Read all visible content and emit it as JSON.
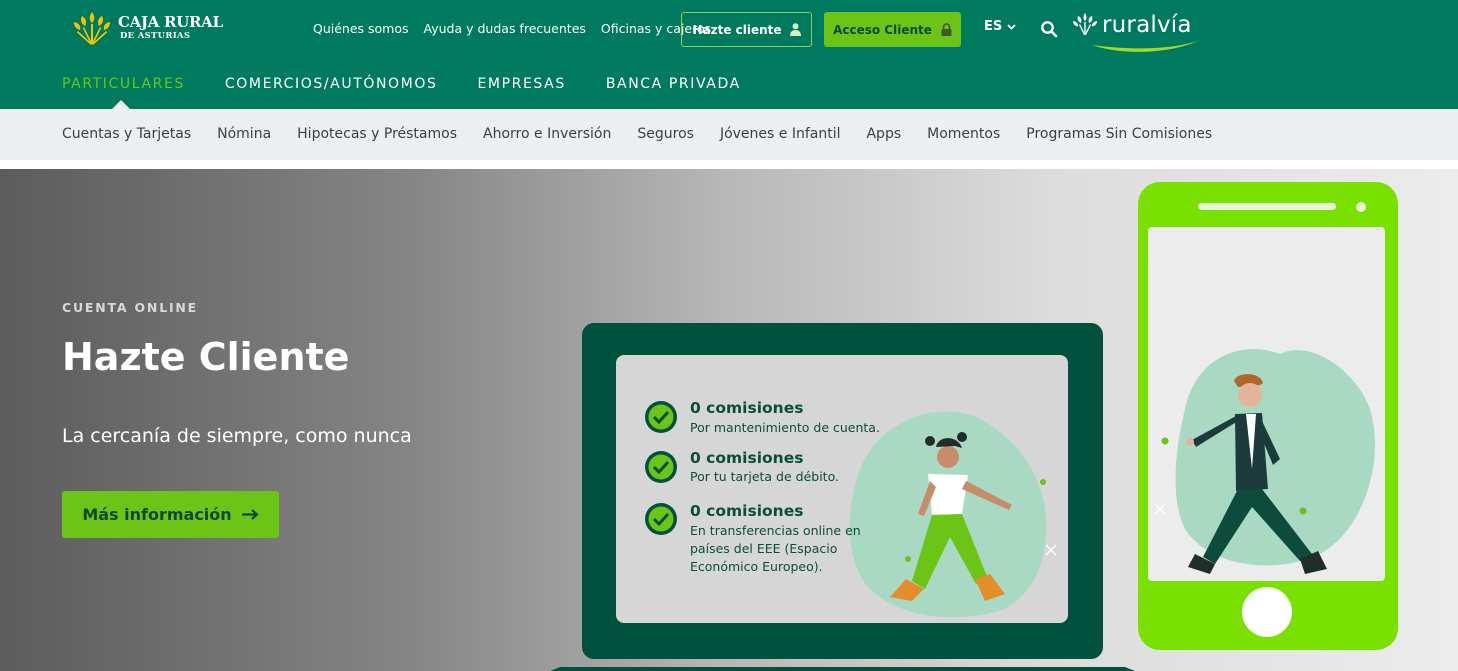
{
  "header": {
    "logo_line1": "CAJA RURAL",
    "logo_line2": "DE ASTURIAS",
    "links": [
      "Quiénes somos",
      "Ayuda y dudas frecuentes",
      "Oficinas y cajeros"
    ],
    "hazte_cliente": "Hazte cliente",
    "acceso_cliente": "Acceso Cliente",
    "language": "ES",
    "ruralvia": "ruralvía",
    "brand_color": "#007a5e",
    "accent_color": "#6cc417"
  },
  "main_nav": {
    "items": [
      "PARTICULARES",
      "COMERCIOS/AUTÓNOMOS",
      "EMPRESAS",
      "BANCA PRIVADA"
    ],
    "active": "PARTICULARES"
  },
  "sub_nav": {
    "items": [
      "Cuentas y Tarjetas",
      "Nómina",
      "Hipotecas y Préstamos",
      "Ahorro e Inversión",
      "Seguros",
      "Jóvenes e Infantil",
      "Apps",
      "Momentos",
      "Programas Sin Comisiones"
    ]
  },
  "hero": {
    "eyebrow": "CUENTA ONLINE",
    "title": "Hazte Cliente",
    "subtitle": "La cercanía de siempre, como nunca",
    "button": "Más información",
    "promo": [
      {
        "title": "0 comisiones",
        "lines": [
          "Por mantenimiento de cuenta."
        ]
      },
      {
        "title": "0 comisiones",
        "lines": [
          "Por tu tarjeta de débito."
        ]
      },
      {
        "title": "0 comisiones",
        "lines": [
          "En transferencias online en",
          "países del EEE (Espacio",
          "Económico Europeo)."
        ]
      }
    ]
  }
}
